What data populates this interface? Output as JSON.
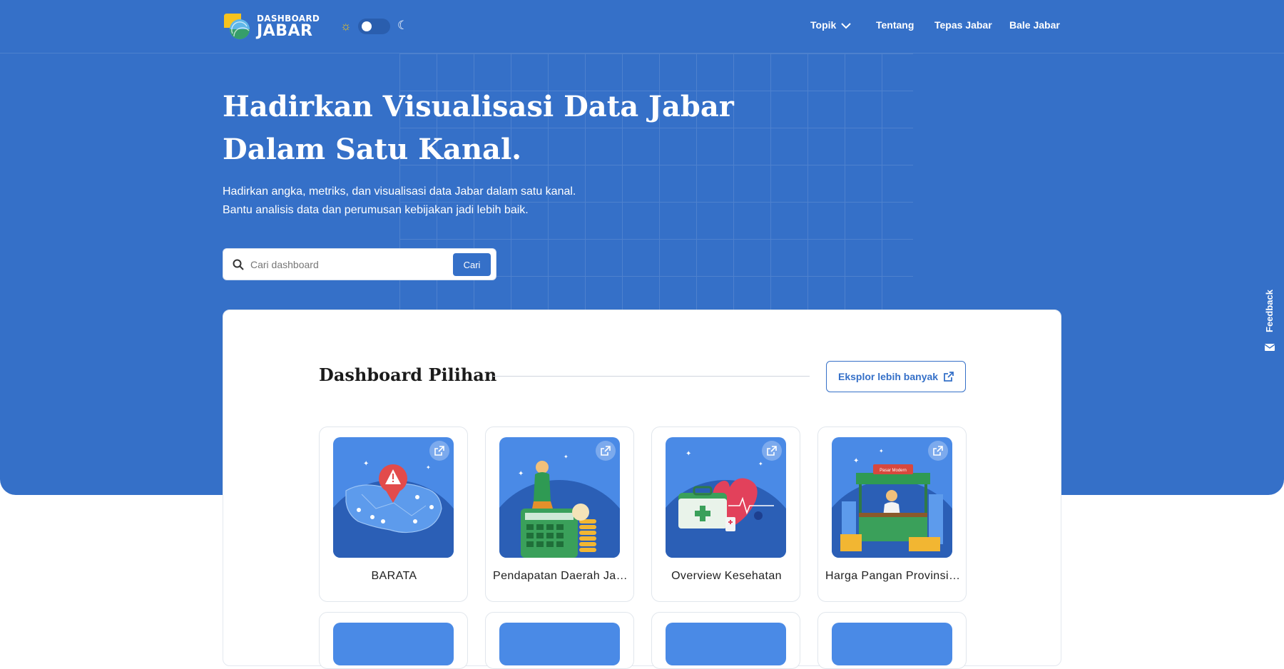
{
  "brand": {
    "small": "DASHBOARD",
    "big": "JABAR"
  },
  "nav": {
    "topik": "Topik",
    "tentang": "Tentang",
    "tepas": "Tepas Jabar",
    "bale": "Bale Jabar"
  },
  "hero": {
    "title_line1": "Hadirkan Visualisasi Data Jabar",
    "title_line2": "Dalam Satu Kanal.",
    "subtitle_line1": "Hadirkan angka, metriks, dan visualisasi data Jabar dalam satu kanal.",
    "subtitle_line2": "Bantu analisis data dan perumusan kebijakan jadi lebih baik."
  },
  "search": {
    "placeholder": "Cari dashboard",
    "button": "Cari"
  },
  "feedback": {
    "label": "Feedback"
  },
  "section": {
    "title": "Dashboard Pilihan",
    "explore_label": "Eksplor lebih banyak",
    "tiles": [
      {
        "label": "BARATA",
        "icon": "map-alert-illustration"
      },
      {
        "label": "Pendapatan Daerah Jawa Barat",
        "icon": "calculator-coins-illustration"
      },
      {
        "label": "Overview Kesehatan",
        "icon": "medkit-heart-illustration"
      },
      {
        "label": "Harga Pangan Provinsi Jawa Barat",
        "icon": "market-stall-illustration"
      }
    ]
  },
  "colors": {
    "primary": "#3570c8",
    "tile_bg": "#4a8ae6",
    "tile_circle": "#2b5fb6"
  }
}
